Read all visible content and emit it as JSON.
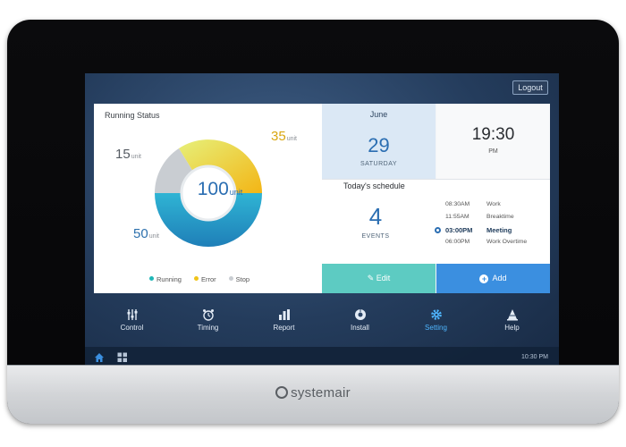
{
  "screen": {
    "logout_label": "Logout"
  },
  "running_status": {
    "title": "Running Status",
    "total_value": "100",
    "total_unit": "unit",
    "segments": [
      {
        "name": "Running",
        "value": "50",
        "unit": "unit",
        "color": "#2aa7c9"
      },
      {
        "name": "Error",
        "value": "35",
        "unit": "unit",
        "color": "#f0c419"
      },
      {
        "name": "Stop",
        "value": "15",
        "unit": "unit",
        "color": "#c9cdd2"
      }
    ],
    "legend": [
      {
        "label": "Running",
        "color": "#1fb7b7"
      },
      {
        "label": "Error",
        "color": "#f0c419"
      },
      {
        "label": "Stop",
        "color": "#c9cdd2"
      }
    ]
  },
  "date": {
    "month": "June",
    "day": "29",
    "weekday": "SATURDAY"
  },
  "clock": {
    "time": "19:30",
    "ampm": "PM"
  },
  "schedule": {
    "title": "Today's schedule",
    "events_count": "4",
    "events_label": "EVENTS",
    "items": [
      {
        "time": "08:30AM",
        "name": "Work"
      },
      {
        "time": "11:55AM",
        "name": "Breaktime"
      },
      {
        "time": "03:00PM",
        "name": "Meeting"
      },
      {
        "time": "06:00PM",
        "name": "Work Overtime"
      }
    ],
    "edit_label": "Edit",
    "add_label": "Add"
  },
  "nav": {
    "items": [
      {
        "label": "Control",
        "icon": "sliders-icon"
      },
      {
        "label": "Timing",
        "icon": "alarm-clock-icon"
      },
      {
        "label": "Report",
        "icon": "bar-chart-icon"
      },
      {
        "label": "Install",
        "icon": "install-icon"
      },
      {
        "label": "Setting",
        "icon": "gear-icon"
      },
      {
        "label": "Help",
        "icon": "cone-icon"
      }
    ],
    "active": "Setting"
  },
  "status_bar": {
    "clock": "10:30 PM"
  },
  "device": {
    "brand": "systemair"
  },
  "colors": {
    "accent": "#3b8fe0",
    "teal": "#5dcbc2",
    "screen_bg": "#243c5c"
  }
}
